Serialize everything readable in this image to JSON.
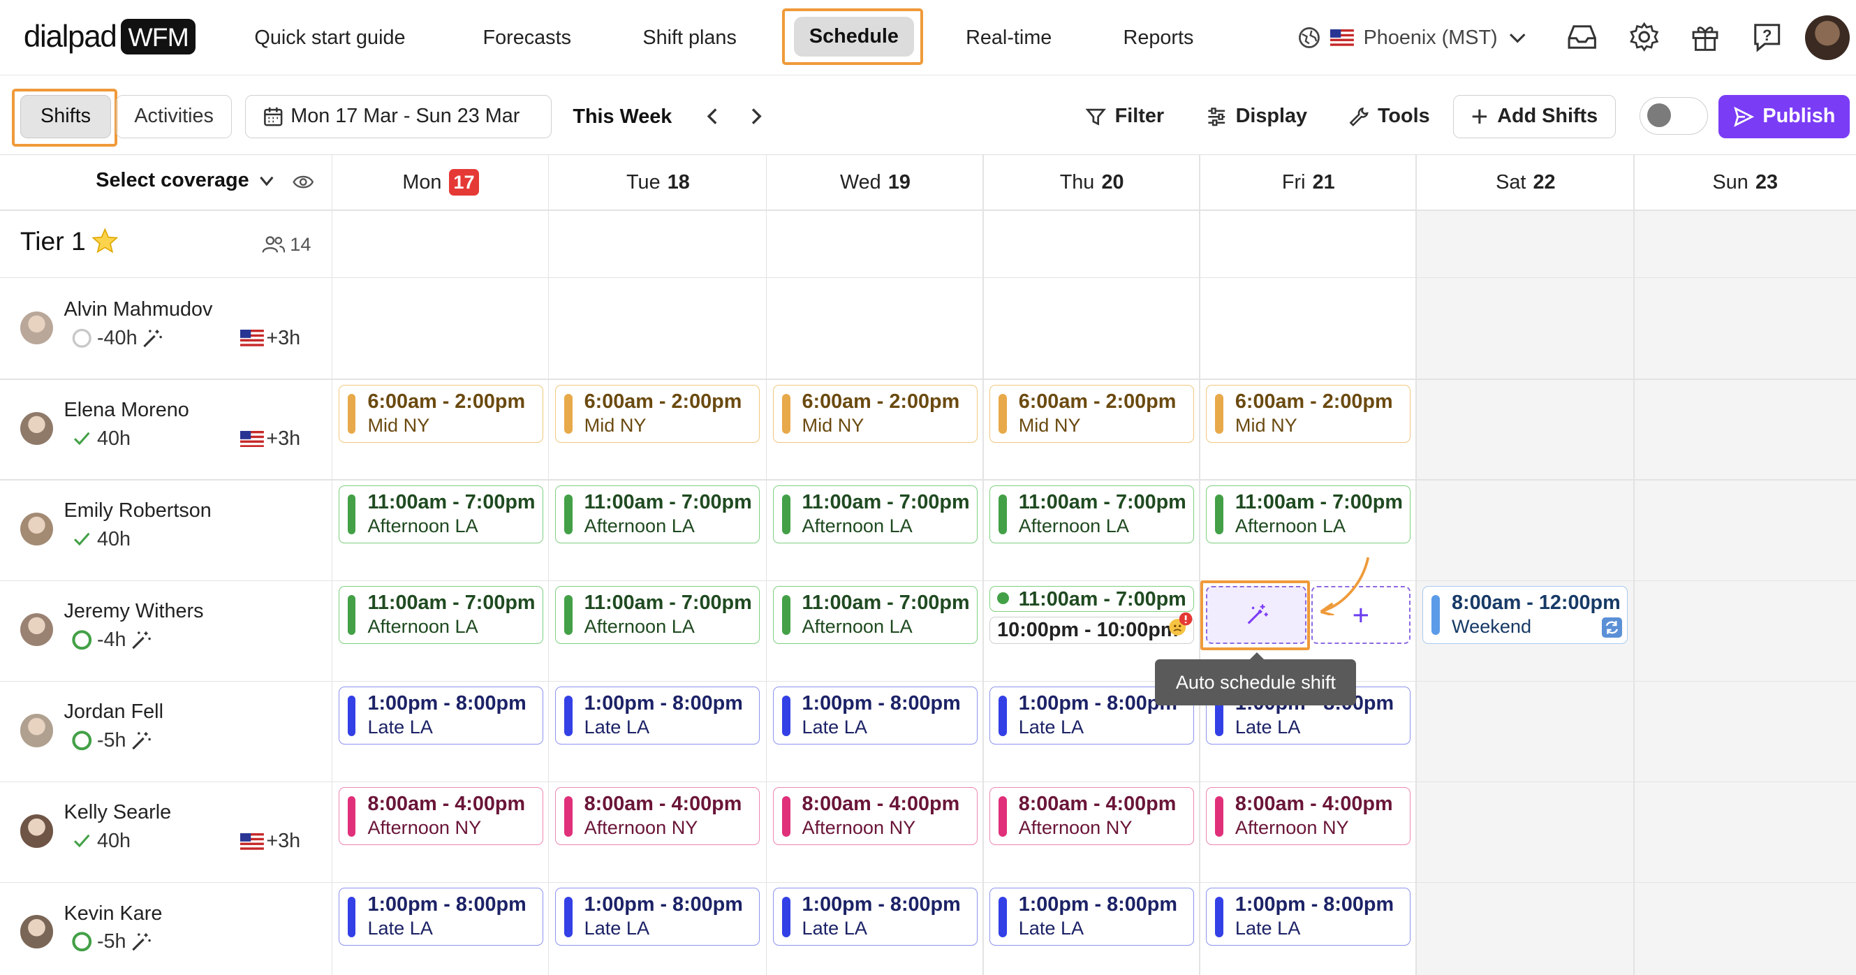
{
  "brand": {
    "name": "dialpad",
    "badge": "WFM"
  },
  "nav": {
    "quick_start": "Quick start guide",
    "forecasts": "Forecasts",
    "shift_plans": "Shift plans",
    "schedule": "Schedule",
    "realtime": "Real-time",
    "reports": "Reports"
  },
  "timezone": "Phoenix (MST)",
  "toolbar": {
    "shifts": "Shifts",
    "activities": "Activities",
    "date_range": "Mon 17 Mar - Sun 23 Mar",
    "this_week": "This Week",
    "filter": "Filter",
    "display": "Display",
    "tools": "Tools",
    "add_shifts": "Add Shifts",
    "publish": "Publish"
  },
  "coverage_label": "Select coverage",
  "days": [
    {
      "dow": "Mon",
      "num": "17",
      "today": true
    },
    {
      "dow": "Tue",
      "num": "18"
    },
    {
      "dow": "Wed",
      "num": "19"
    },
    {
      "dow": "Thu",
      "num": "20"
    },
    {
      "dow": "Fri",
      "num": "21"
    },
    {
      "dow": "Sat",
      "num": "22"
    },
    {
      "dow": "Sun",
      "num": "23"
    }
  ],
  "tier": {
    "name": "Tier 1",
    "count": "14"
  },
  "people": [
    {
      "name": "Alvin Mahmudov",
      "hours": "-40h",
      "status": "empty",
      "offset": "+3h"
    },
    {
      "name": "Elena Moreno",
      "hours": "40h",
      "status": "ok",
      "offset": "+3h"
    },
    {
      "name": "Emily Robertson",
      "hours": "40h",
      "status": "ok",
      "offset": ""
    },
    {
      "name": "Jeremy Withers",
      "hours": "-4h",
      "status": "partial",
      "offset": ""
    },
    {
      "name": "Jordan Fell",
      "hours": "-5h",
      "status": "partial",
      "offset": ""
    },
    {
      "name": "Kelly Searle",
      "hours": "40h",
      "status": "ok",
      "offset": "+3h"
    },
    {
      "name": "Kevin Kare",
      "hours": "-5h",
      "status": "partial",
      "offset": ""
    }
  ],
  "shift_types": {
    "mid_ny": {
      "time": "6:00am - 2:00pm",
      "label": "Mid NY",
      "bar": "#e8a94a",
      "border": "#f1c77e",
      "text": "#6b4a10"
    },
    "afternoon_la": {
      "time": "11:00am - 7:00pm",
      "label": "Afternoon LA",
      "bar": "#43a047",
      "border": "#7ed07f",
      "text": "#1f4a20"
    },
    "late_la": {
      "time": "1:00pm - 8:00pm",
      "label": "Late LA",
      "bar": "#3340e6",
      "border": "#8c93ee",
      "text": "#1c2266"
    },
    "afternoon_ny": {
      "time": "8:00am - 4:00pm",
      "label": "Afternoon NY",
      "bar": "#e0307a",
      "border": "#ee86b3",
      "text": "#6a1538"
    },
    "weekend": {
      "time": "8:00am - 12:00pm",
      "label": "Weekend",
      "bar": "#5b9be8",
      "border": "#a9c8ee",
      "text": "#173a66"
    }
  },
  "extra_shift_time": "10:00pm - 10:00pm",
  "auto_schedule_tooltip": "Auto schedule shift",
  "colors": {
    "accent": "#7b3cf6",
    "highlight": "#ef9a3a",
    "today": "#e53935"
  }
}
